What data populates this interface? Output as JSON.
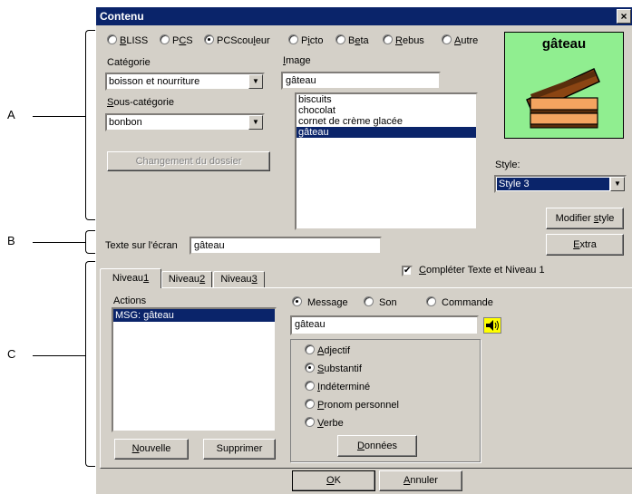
{
  "annotations": {
    "a": "A",
    "b": "B",
    "c": "C"
  },
  "window": {
    "title": "Contenu",
    "close": "×"
  },
  "symbol_sets": [
    {
      "pre": "",
      "ul": "B",
      "post": "LISS",
      "selected": false
    },
    {
      "pre": "P",
      "ul": "C",
      "post": "S",
      "selected": false
    },
    {
      "pre": "PCScou",
      "ul": "l",
      "post": "eur",
      "selected": true
    },
    {
      "pre": "P",
      "ul": "i",
      "post": "cto",
      "selected": false
    },
    {
      "pre": "B",
      "ul": "e",
      "post": "ta",
      "selected": false
    },
    {
      "pre": "",
      "ul": "R",
      "post": "ebus",
      "selected": false
    },
    {
      "pre": "",
      "ul": "A",
      "post": "utre",
      "selected": false
    }
  ],
  "categorie": {
    "label": "Catégorie",
    "value": "boisson et nourriture"
  },
  "sous_categorie": {
    "label_ul": "S",
    "label_rest": "ous-catégorie",
    "value": "bonbon"
  },
  "changement_button": "Changement du dossier",
  "image": {
    "label_ul": "I",
    "label_rest": "mage",
    "value": "gâteau",
    "list": [
      "biscuits",
      "chocolat",
      "cornet de crème glacée",
      "gâteau"
    ],
    "selected_index": 3
  },
  "preview": {
    "caption": "gâteau",
    "bg_color": "#90ee90",
    "icon": "cake-slice-icon"
  },
  "style": {
    "label": "Style:",
    "value": "Style 3"
  },
  "modifier_style_button": {
    "pre": "Modifier ",
    "ul": "s",
    "post": "tyle"
  },
  "extra_button": {
    "ul": "E",
    "post": "xtra"
  },
  "texte_ecran": {
    "label": "Texte sur l'écran",
    "value": "gâteau"
  },
  "completer": {
    "pre": "",
    "ul": "C",
    "post": "ompléter Texte et Niveau 1",
    "checked": true
  },
  "tabs": [
    {
      "pre": "Niveau",
      "ul": "1"
    },
    {
      "pre": "Niveau",
      "ul": "2"
    },
    {
      "pre": "Niveau",
      "ul": "3"
    }
  ],
  "actions": {
    "label": "Actions",
    "items": [
      "MSG: gâteau"
    ],
    "selected_index": 0
  },
  "nouvelle_button": {
    "ul": "N",
    "post": "ouvelle"
  },
  "supprimer_button": "Supprimer",
  "action_types": [
    {
      "label": "Message",
      "selected": true
    },
    {
      "label": "Son",
      "selected": false
    },
    {
      "label": "Commande",
      "selected": false
    }
  ],
  "message_value": "gâteau",
  "speaker_icon": "speaker-icon",
  "word_types": [
    {
      "pre": "",
      "ul": "A",
      "post": "djectif",
      "selected": false
    },
    {
      "pre": "",
      "ul": "S",
      "post": "ubstantif",
      "selected": true
    },
    {
      "pre": "",
      "ul": "I",
      "post": "ndéterminé",
      "selected": false
    },
    {
      "pre": "",
      "ul": "P",
      "post": "ronom personnel",
      "selected": false
    },
    {
      "pre": "",
      "ul": "V",
      "post": "erbe",
      "selected": false
    }
  ],
  "donnees_button": {
    "ul": "D",
    "post": "onnées"
  },
  "ok_button": {
    "ul": "O",
    "post": "K"
  },
  "annuler_button": {
    "ul": "A",
    "post": "nnuler"
  }
}
